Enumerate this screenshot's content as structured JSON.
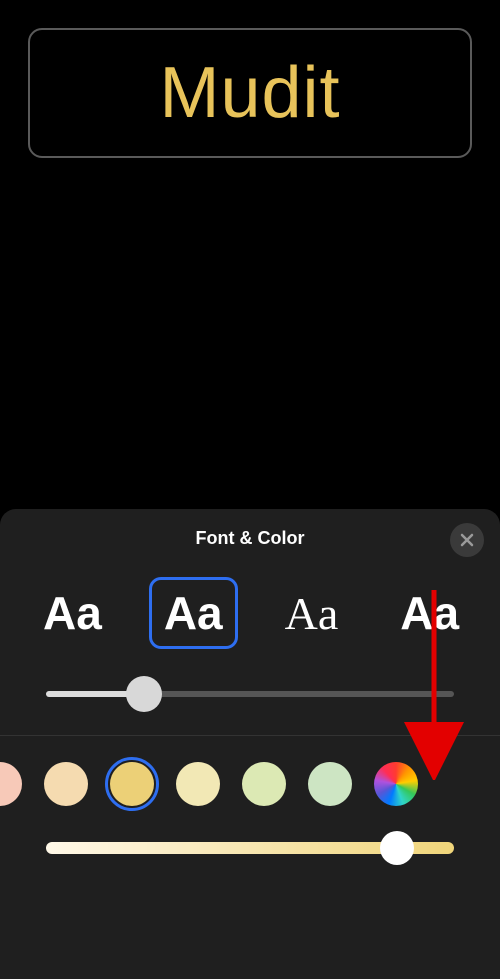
{
  "preview": {
    "name": "Mudit",
    "textColor": "#e8c35a"
  },
  "sheet": {
    "title": "Font & Color",
    "closeLabel": "Close",
    "fonts": [
      {
        "label": "Aa",
        "style": "sans-bold",
        "selected": false
      },
      {
        "label": "Aa",
        "style": "sans-regular",
        "selected": true
      },
      {
        "label": "Aa",
        "style": "serif",
        "selected": false
      },
      {
        "label": "Aa",
        "style": "heavy",
        "selected": false
      }
    ],
    "weightSlider": {
      "value": 24,
      "min": 0,
      "max": 100
    },
    "colors": [
      {
        "hex": "#f7c9b8",
        "selected": false,
        "partial": true
      },
      {
        "hex": "#f5dbb0",
        "selected": false
      },
      {
        "hex": "#ecd077",
        "selected": true
      },
      {
        "hex": "#f2e8b5",
        "selected": false
      },
      {
        "hex": "#dce9b4",
        "selected": false
      },
      {
        "hex": "#cde5c3",
        "selected": false
      }
    ],
    "colorPickerLabel": "Custom Color",
    "brightnessSlider": {
      "value": 86,
      "min": 0,
      "max": 100
    }
  }
}
